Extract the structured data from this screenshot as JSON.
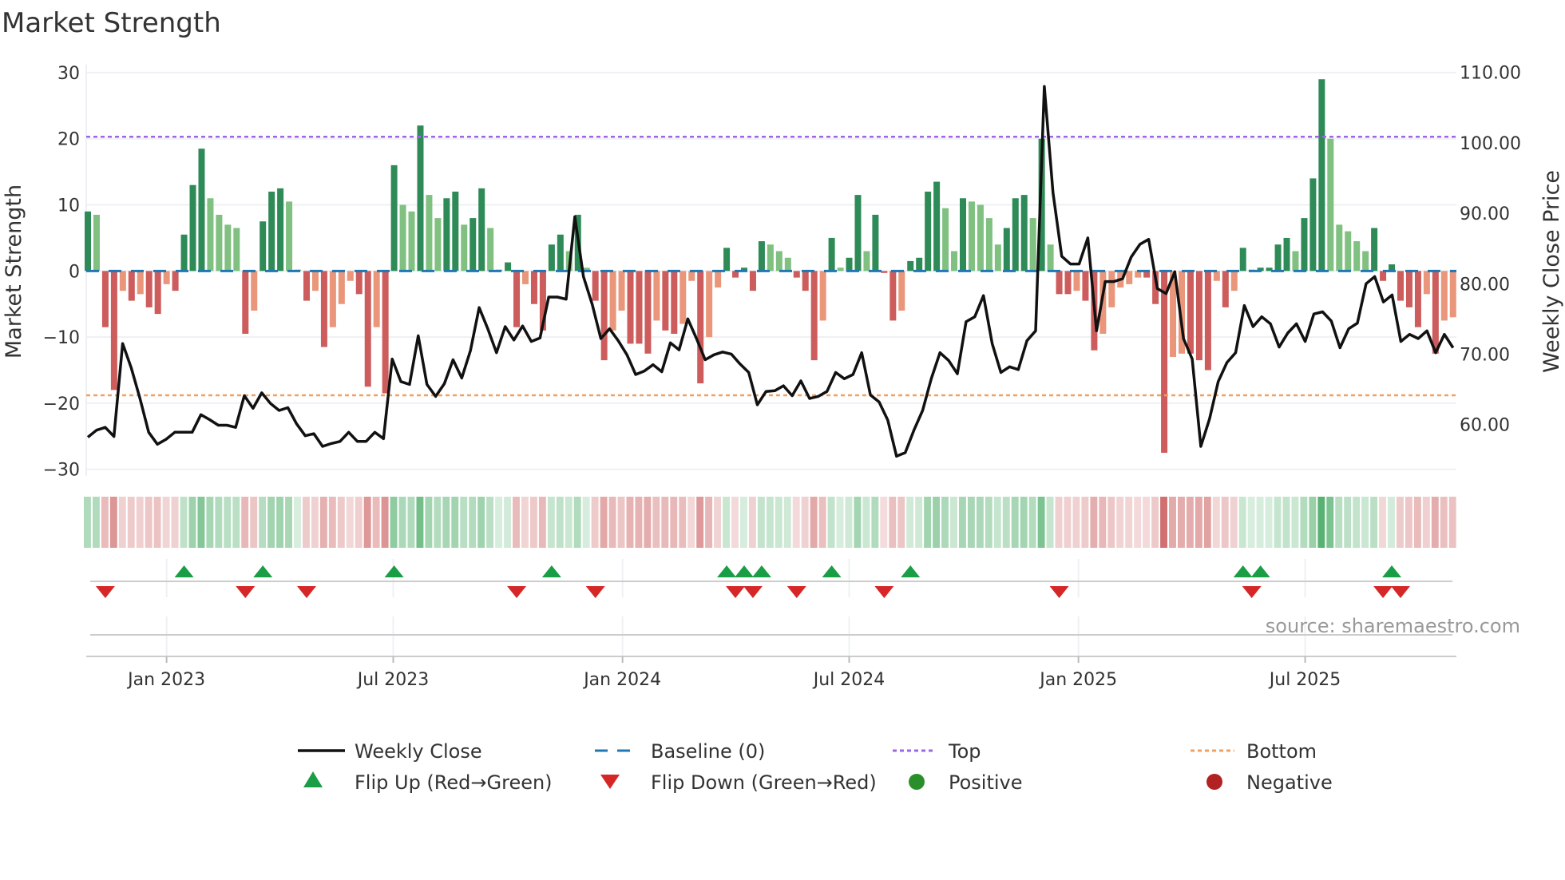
{
  "chart_data": {
    "type": "bar",
    "title": "Market Strength",
    "ylabel": "Market Strength",
    "y2label": "Weekly Close Price",
    "ylim": [
      -31,
      31.2
    ],
    "y2lim": [
      52.7,
      111.1
    ],
    "yticks": [
      30,
      20,
      10,
      0,
      -10,
      -20,
      -30
    ],
    "ytick_labels": [
      "30",
      "20",
      "10",
      "0",
      "−10",
      "−20",
      "−30"
    ],
    "y2ticks": [
      110,
      100,
      90,
      80,
      70,
      60
    ],
    "y2tick_labels": [
      "110.00",
      "100.00",
      "90.00",
      "80.00",
      "70.00",
      "60.00"
    ],
    "xticks": [
      {
        "week": 9.0,
        "label": "Jan 2023"
      },
      {
        "week": 34.9,
        "label": "Jul 2023"
      },
      {
        "week": 61.1,
        "label": "Jan 2024"
      },
      {
        "week": 87.0,
        "label": "Jul 2024"
      },
      {
        "week": 113.2,
        "label": "Jan 2025"
      },
      {
        "week": 139.1,
        "label": "Jul 2025"
      }
    ],
    "top": 20.3,
    "bottom": -18.8,
    "baseline": 0,
    "strength": [
      9,
      8.5,
      -8.5,
      -18,
      -3,
      -4.5,
      -3.5,
      -5.5,
      -6.5,
      -2,
      -3,
      5.5,
      13,
      18.5,
      11,
      8.5,
      7,
      6.5,
      -9.5,
      -6,
      7.5,
      12,
      12.5,
      10.5,
      0.2,
      -4.5,
      -3,
      -11.5,
      -8.5,
      -5,
      -1.5,
      -3.5,
      -17.5,
      -8.5,
      -18.5,
      16,
      10,
      9,
      22,
      11.5,
      8,
      11,
      12,
      7,
      8,
      12.5,
      6.5,
      0.2,
      1.3,
      -8.5,
      -2,
      -5,
      -9,
      4,
      5.5,
      3,
      8.5,
      0.5,
      -4.5,
      -13.5,
      -9,
      -6,
      -11,
      -11,
      -12.5,
      -7.5,
      -9,
      -9.5,
      -8,
      -1.5,
      -17,
      -10,
      -2.5,
      3.5,
      -1,
      0.5,
      -3,
      4.5,
      4,
      3,
      2,
      -1,
      -3,
      -13.5,
      -7.5,
      5,
      0.5,
      2,
      11.5,
      3,
      8.5,
      -0.3,
      -7.5,
      -6,
      1.5,
      2,
      12,
      13.5,
      9.5,
      3,
      11,
      10.5,
      10,
      8,
      4,
      6.5,
      11,
      11.5,
      8,
      20,
      4,
      -3.5,
      -3.5,
      -3,
      -4.5,
      -12,
      -9.5,
      -5.5,
      -2.5,
      -2,
      -1,
      -1,
      -5,
      -27.5,
      -13,
      -12.5,
      -12.5,
      -13.5,
      -15,
      -1.5,
      -5.5,
      -3,
      3.5,
      0.2,
      0.5,
      0.5,
      4,
      5,
      3,
      8,
      14,
      29,
      20,
      7,
      6,
      4.5,
      3,
      6.5,
      -1.5,
      1,
      -4.5,
      -5.5,
      -8.5,
      -3.5,
      -12.5,
      -7.5,
      -7
    ],
    "weekly_close": [
      58.2,
      59.2,
      59.6,
      58.3,
      71.5,
      68,
      63.7,
      58.9,
      57.2,
      57.9,
      58.9,
      58.9,
      58.9,
      61.4,
      60.7,
      59.9,
      59.9,
      59.6,
      64.1,
      62.3,
      64.5,
      63,
      62,
      62.4,
      60.1,
      58.4,
      58.7,
      56.9,
      57.3,
      57.6,
      58.9,
      57.6,
      57.6,
      58.9,
      58,
      69.3,
      66.1,
      65.7,
      72.6,
      65.7,
      64,
      65.8,
      69.2,
      66.6,
      70.5,
      76.6,
      73.6,
      70.2,
      73.9,
      72,
      74,
      71.8,
      72.3,
      78.1,
      78.1,
      77.8,
      89.5,
      81,
      77.1,
      72.2,
      73.6,
      71.9,
      69.9,
      67.1,
      67.6,
      68.5,
      67.5,
      71.6,
      70.6,
      75,
      72.2,
      69.2,
      69.9,
      70.3,
      70,
      68.6,
      67.4,
      62.8,
      64.7,
      64.8,
      65.5,
      64.1,
      66.2,
      63.7,
      64,
      64.7,
      67.4,
      66.5,
      67.1,
      70.2,
      64.2,
      63.2,
      60.6,
      55.5,
      56,
      59.2,
      62,
      66.5,
      70.2,
      69.1,
      67.2,
      74.6,
      75.3,
      78.3,
      71.5,
      67.4,
      68.2,
      67.8,
      71.9,
      73.3,
      108,
      92.9,
      83.9,
      82.8,
      82.8,
      86.5,
      73.3,
      80.3,
      80.3,
      80.7,
      83.8,
      85.6,
      86.3,
      79.3,
      78.6,
      81.7,
      72.2,
      69.3,
      56.9,
      60.8,
      66.1,
      68.8,
      70.2,
      76.9,
      73.9,
      75.3,
      74.3,
      71,
      73,
      74.3,
      71.8,
      75.7,
      76,
      74.7,
      70.9,
      73.6,
      74.4,
      80,
      81,
      77.4,
      78.4,
      71.8,
      72.8,
      72.2,
      73.3,
      70.2,
      72.8,
      70.9
    ],
    "flip_up_weeks": [
      11,
      20,
      35,
      53,
      73,
      75,
      77,
      85,
      94,
      132,
      134,
      149
    ],
    "flip_down_weeks": [
      2,
      18,
      25,
      49,
      58,
      74,
      76,
      81,
      91,
      111,
      133,
      148,
      150
    ],
    "legend": {
      "weekly_close": "Weekly Close",
      "baseline": "Baseline (0)",
      "top": "Top",
      "bottom": "Bottom",
      "flip_up": "Flip Up (Red→Green)",
      "flip_down": "Flip Down (Green→Red)",
      "positive": "Positive",
      "negative": "Negative"
    },
    "legend_placement": "bottom",
    "source": "source: sharemaestro.com",
    "colors": {
      "strong_pos": "#2e8b57",
      "weak_pos": "#80c080",
      "strong_neg": "#cd5c5c",
      "weak_neg": "#e9967a",
      "line": "#111111",
      "baseline": "#1f77b4",
      "top": "#a064e6",
      "bottom": "#f0a060",
      "flip_up": "#1a9e45",
      "flip_down": "#d62728",
      "positive": "#2a8f2a",
      "negative": "#b22222"
    }
  }
}
